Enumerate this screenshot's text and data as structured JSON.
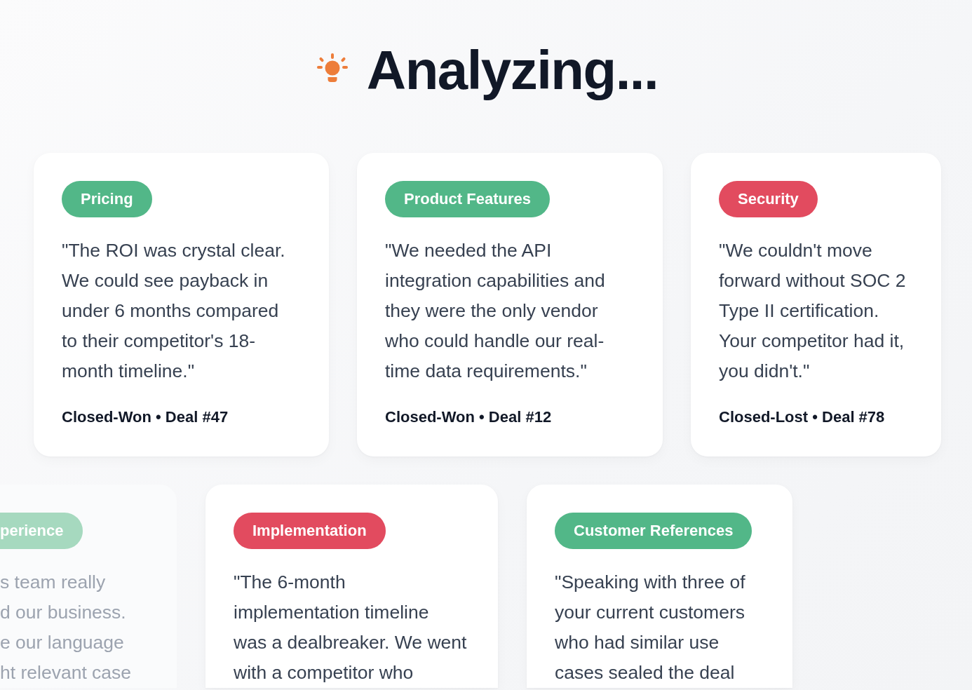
{
  "header": {
    "title": "Analyzing..."
  },
  "rows": [
    {
      "cards": [
        {
          "dimmed": false,
          "tag": {
            "label": "Pricing",
            "color": "#52b788"
          },
          "quote_lines": [
            "\"The ROI was crystal clear.",
            "We could see payback in",
            "under 6 months compared",
            "to their competitor's 18-",
            "month timeline.\""
          ],
          "footer": "Closed-Won • Deal #47"
        },
        {
          "dimmed": false,
          "tag": {
            "label": "Product Features",
            "color": "#52b788"
          },
          "quote_lines": [
            "\"We needed the API",
            "integration capabilities and",
            "they were the only vendor",
            "who could handle our real-",
            "time data requirements.\""
          ],
          "footer": "Closed-Won • Deal #12"
        },
        {
          "dimmed": false,
          "tag": {
            "label": "Security",
            "color": "#e24b5f"
          },
          "quote_lines": [
            "\"We couldn't move",
            "forward without SOC 2",
            "Type II certification.",
            "Your competitor had it,",
            "you didn't.\""
          ],
          "footer": "Closed-Lost • Deal #78"
        }
      ]
    },
    {
      "cards": [
        {
          "dimmed": true,
          "tag": {
            "label": "perience",
            "color": "#a6d9bf"
          },
          "quote_lines": [
            "s team really",
            "d our business.",
            "e our language",
            "ht relevant case"
          ]
        },
        {
          "dimmed": false,
          "tag": {
            "label": "Implementation",
            "color": "#e24b5f"
          },
          "quote_lines": [
            "\"The 6-month",
            "implementation timeline",
            "was a dealbreaker. We went",
            "with a competitor who"
          ]
        },
        {
          "dimmed": false,
          "tag": {
            "label": "Customer References",
            "color": "#52b788"
          },
          "quote_lines": [
            "\"Speaking with three of",
            "your current customers",
            "who had similar use",
            "cases sealed the deal"
          ]
        }
      ]
    }
  ]
}
